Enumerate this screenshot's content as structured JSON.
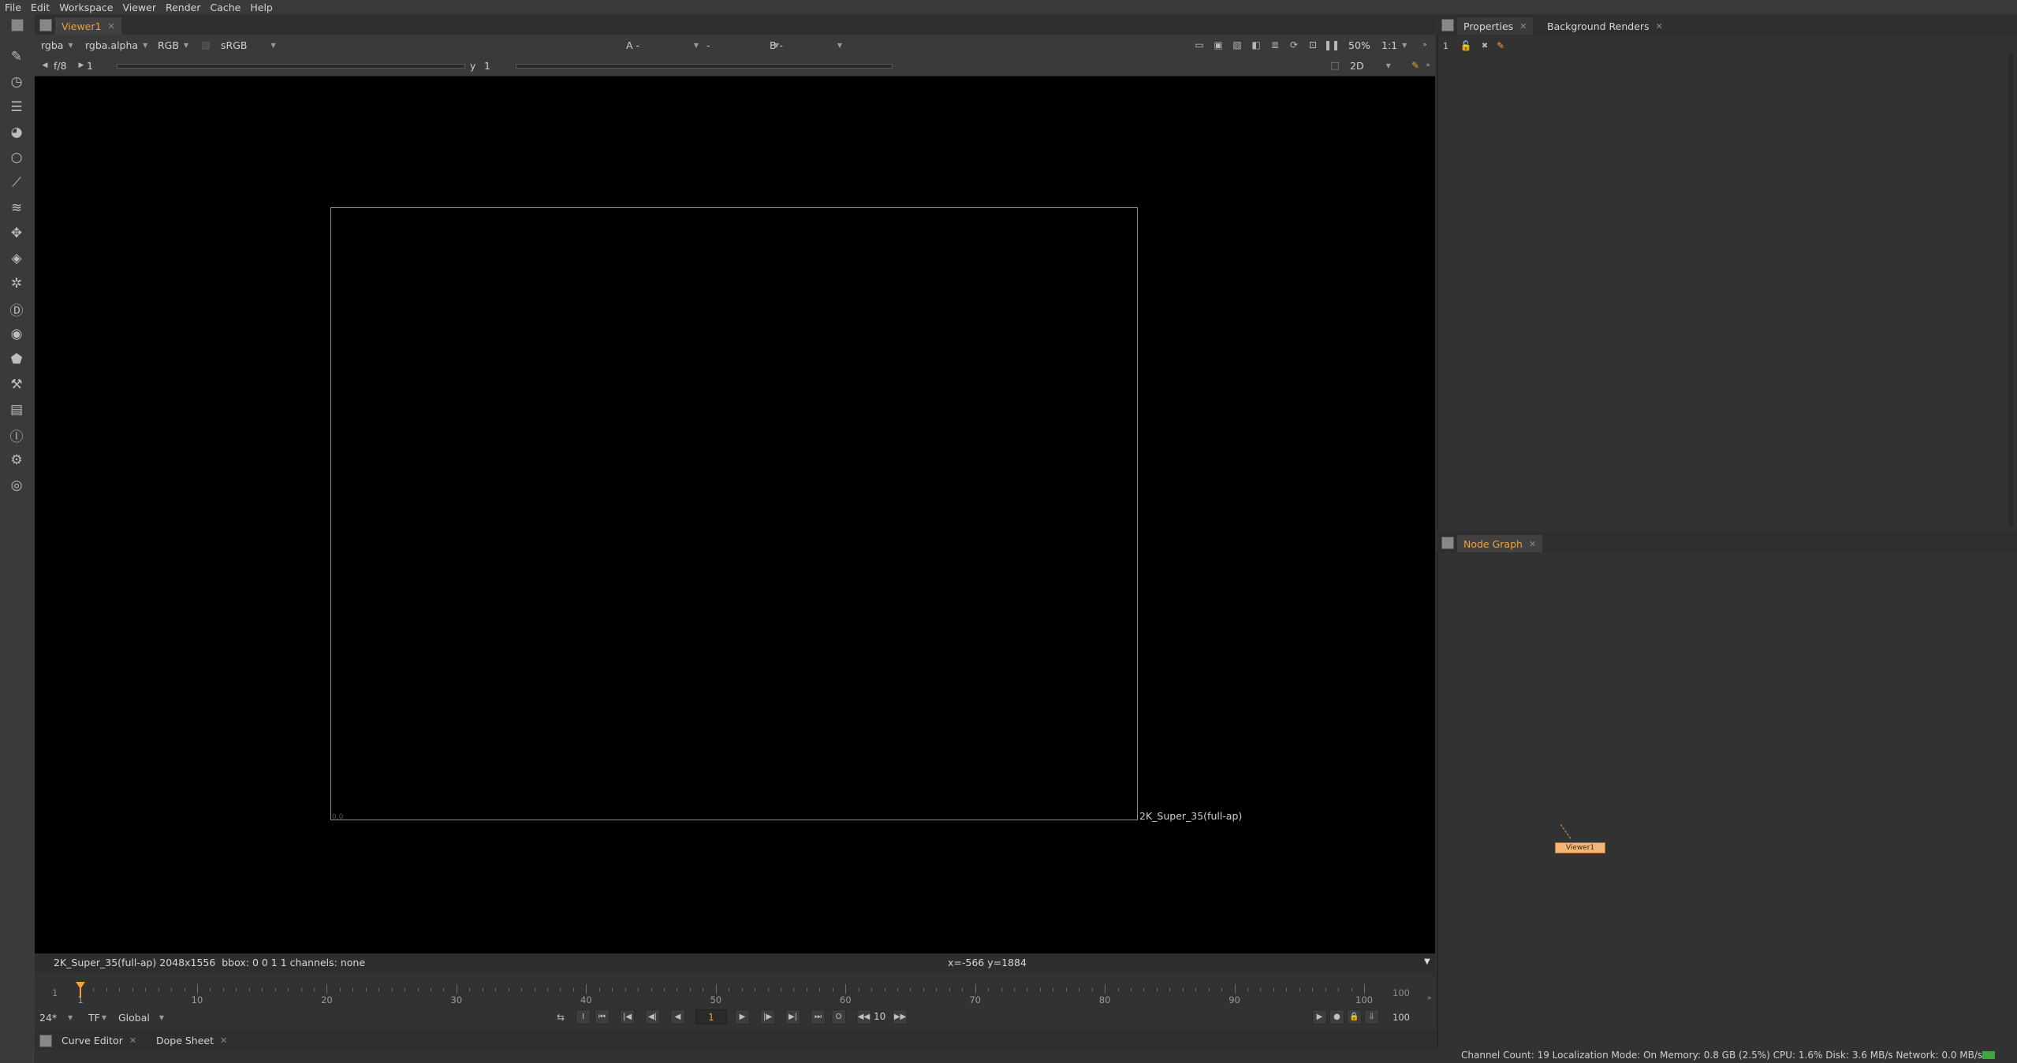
{
  "menu": [
    "File",
    "Edit",
    "Workspace",
    "Viewer",
    "Render",
    "Cache",
    "Help"
  ],
  "viewer": {
    "tab": "Viewer1",
    "channels": "rgba",
    "alpha": "rgba.alpha",
    "colorspace": "RGB",
    "lut": "sRGB",
    "input_a": "A -",
    "input_mid": "-",
    "input_b": "B -",
    "zoom": "50%",
    "ratio": "1:1",
    "fstop": "f/8",
    "frame_field": "1",
    "y_label": "y",
    "y_value": "1",
    "mode": "2D",
    "format_label": "2K_Super_35(full-ap)",
    "corner_label": "0,0",
    "info_left": "2K_Super_35(full-ap) 2048x1556  bbox: 0 0 1 1 channels: none",
    "info_coords": "x=-566 y=1884"
  },
  "timeline": {
    "start": "1",
    "end": "100",
    "labels": [
      "1",
      "10",
      "20",
      "30",
      "40",
      "50",
      "60",
      "70",
      "80",
      "90",
      "100"
    ],
    "current_frame": "1",
    "fps": "24*",
    "tf": "TF",
    "range_mode": "Global",
    "step": "10",
    "end_field": "100"
  },
  "bottom_tabs": [
    "Curve Editor",
    "Dope Sheet"
  ],
  "properties": {
    "tab": "Properties",
    "tab2": "Background Renders",
    "count": "1"
  },
  "nodegraph": {
    "tab": "Node Graph",
    "node_label": "Viewer1"
  },
  "status": "Channel Count: 19  Localization Mode: On  Memory: 0.8 GB (2.5%)  CPU: 1.6%  Disk: 3.6 MB/s  Network: 0.0 MB/s",
  "icons": [
    "pencil-icon",
    "clock-icon",
    "layers-icon",
    "color-wheel-icon",
    "circle-icon",
    "curve-icon",
    "stack-icon",
    "move-icon",
    "cube-icon",
    "particle-icon",
    "d-icon",
    "eye-icon",
    "tag-icon",
    "wrench-icon",
    "film-icon",
    "circle-l-icon",
    "gear-cluster-icon",
    "target-icon"
  ],
  "accent": "#f1a13a"
}
